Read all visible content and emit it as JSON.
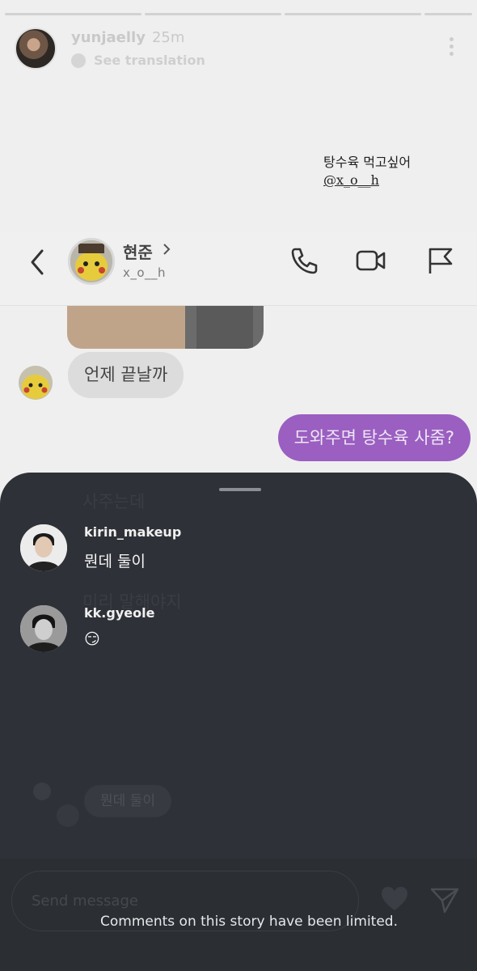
{
  "story": {
    "username": "yunjaelly",
    "time_ago": "25m",
    "see_translation": "See translation",
    "caption_line1": "탕수육 먹고싶어",
    "caption_mention": "@x_o__h",
    "more_icon": "more-vertical-icon"
  },
  "dm": {
    "contact_name": "현준",
    "contact_handle": "x_o__h",
    "icons": [
      "back-icon",
      "chevron-right-icon",
      "phone-icon",
      "video-icon",
      "flag-icon"
    ],
    "incoming_message": "언제 끝날까",
    "outgoing_message": "도와주면 탕수육 사줌?",
    "outgoing_color": "#9a5fc0"
  },
  "sheet": {
    "ghost_text_1": "사주는데",
    "ghost_text_2": "미리 말해야지",
    "ghost_reply": "뭔데 둘이",
    "comments": [
      {
        "username": "kirin_makeup",
        "text": "뭔데 둘이"
      },
      {
        "username": "kk.gyeole",
        "text": "😏"
      }
    ],
    "input_placeholder": "Send message",
    "limited_note": "Comments on this story have been limited.",
    "background_color": "#2e3137"
  }
}
